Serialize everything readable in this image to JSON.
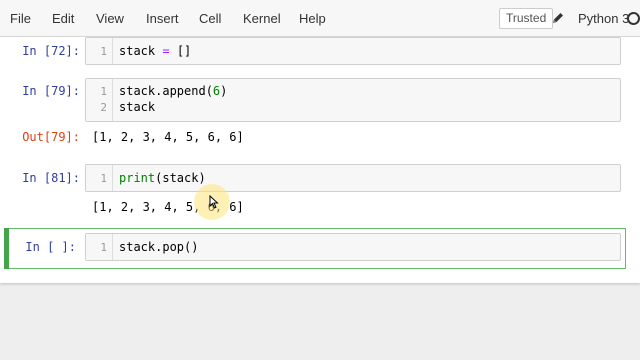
{
  "menu": {
    "items": [
      "File",
      "Edit",
      "View",
      "Insert",
      "Cell",
      "Kernel",
      "Help"
    ]
  },
  "toolbar": {
    "trusted_label": "Trusted",
    "kernel_name": "Python 3"
  },
  "cells": [
    {
      "prompt": "In [72]:",
      "lines": [
        "stack = []"
      ]
    },
    {
      "prompt": "In [79]:",
      "lines": [
        "stack.append(6)",
        "stack"
      ],
      "out_prompt": "Out[79]:",
      "output": "[1, 2, 3, 4, 5, 6, 6]"
    },
    {
      "prompt": "In [81]:",
      "lines": [
        "print(stack)"
      ],
      "output": "[1, 2, 3, 4, 5, 6, 6]"
    },
    {
      "prompt": "In [ ]:",
      "lines": [
        "stack.pop()"
      ],
      "selected": true
    }
  ],
  "line_numbers": [
    "1",
    "2"
  ],
  "colors": {
    "selected_border": "#42a548",
    "in_prompt": "#303f9f",
    "out_prompt": "#d84315",
    "keyword": "#008000"
  },
  "icons": [
    "pencil-icon",
    "kernel-idle-icon",
    "mouse-cursor-icon"
  ]
}
